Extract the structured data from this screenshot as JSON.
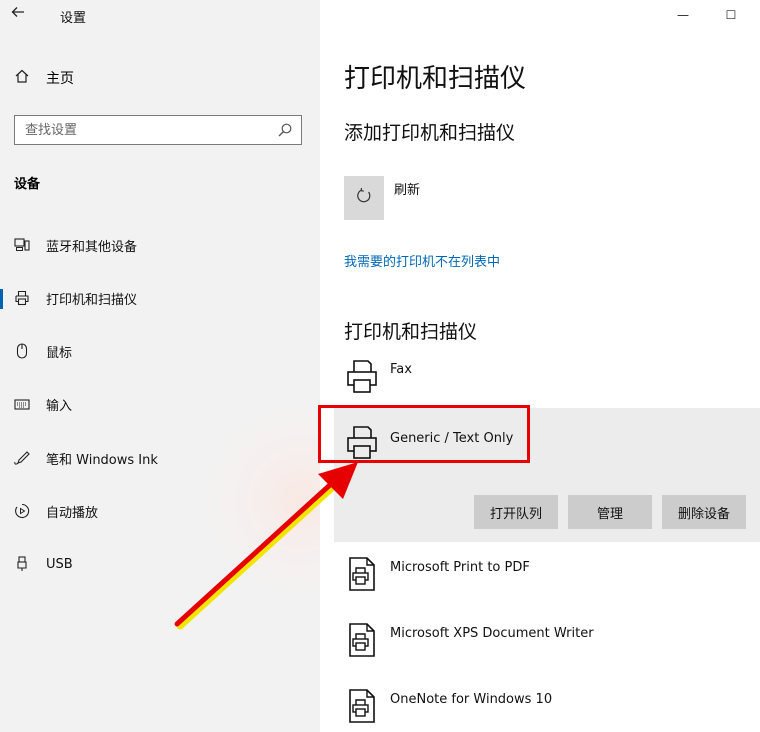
{
  "window": {
    "title": "设置",
    "minimize_glyph": "—",
    "maximize_glyph": "☐"
  },
  "sidebar": {
    "home_label": "主页",
    "search_placeholder": "查找设置",
    "section_label": "设备",
    "items": [
      {
        "label": "蓝牙和其他设备",
        "icon": "bluetooth-devices-icon"
      },
      {
        "label": "打印机和扫描仪",
        "icon": "printer-icon",
        "selected": true
      },
      {
        "label": "鼠标",
        "icon": "mouse-icon"
      },
      {
        "label": "输入",
        "icon": "keyboard-icon"
      },
      {
        "label": "笔和 Windows Ink",
        "icon": "pen-icon"
      },
      {
        "label": "自动播放",
        "icon": "autoplay-icon"
      },
      {
        "label": "USB",
        "icon": "usb-icon"
      }
    ]
  },
  "main": {
    "title": "打印机和扫描仪",
    "add_heading": "添加打印机和扫描仪",
    "refresh_label": "刷新",
    "not_listed_link": "我需要的打印机不在列表中",
    "list_heading": "打印机和扫描仪",
    "printers": [
      {
        "name": "Fax"
      },
      {
        "name": "Generic / Text Only",
        "selected": true
      },
      {
        "name": "Microsoft Print to PDF"
      },
      {
        "name": "Microsoft XPS Document Writer"
      },
      {
        "name": "OneNote for Windows 10"
      }
    ],
    "actions": {
      "open_queue": "打开队列",
      "manage": "管理",
      "remove": "删除设备"
    }
  },
  "colors": {
    "accent": "#0063b1",
    "link": "#0066b4",
    "highlight_box": "#e60000",
    "arrow": "#e60000",
    "arrow_edge": "#f2e600"
  }
}
